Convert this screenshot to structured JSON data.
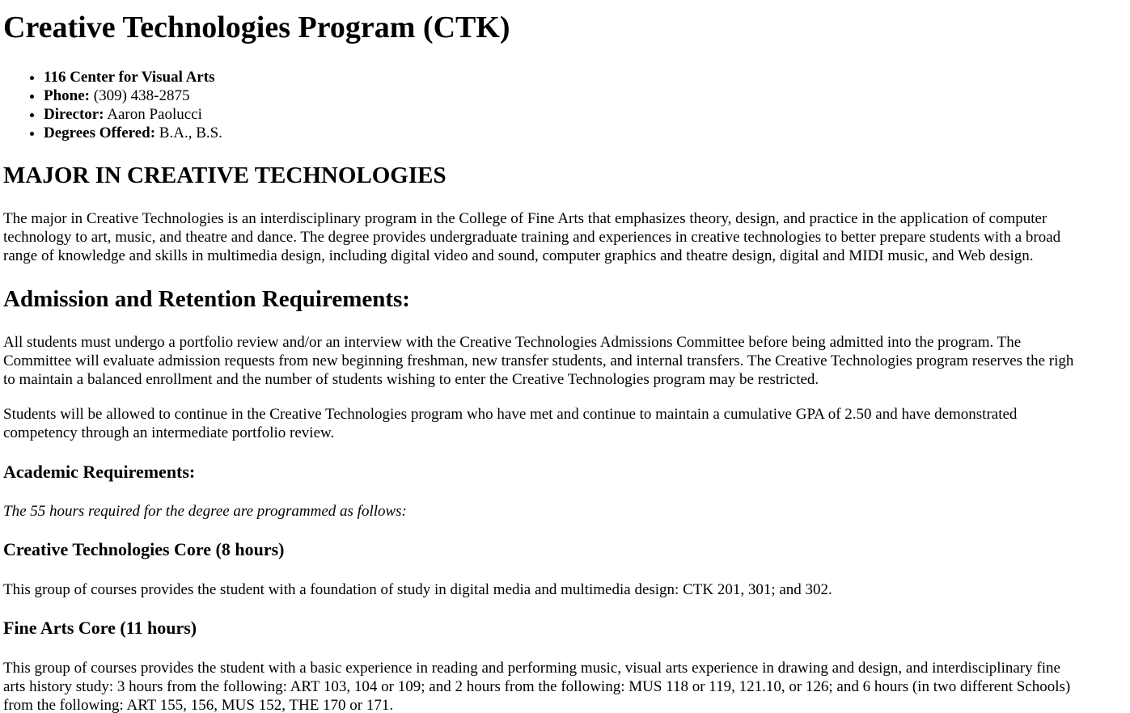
{
  "page_title": "Creative Technologies Program (CTK)",
  "info": {
    "location": "116 Center for Visual Arts",
    "phone_label": "Phone:",
    "phone_value": " (309) 438-2875",
    "director_label": "Director:",
    "director_value": " Aaron Paolucci",
    "degrees_label": "Degrees Offered:",
    "degrees_value": " B.A., B.S."
  },
  "major": {
    "heading": "MAJOR IN CREATIVE TECHNOLOGIES",
    "lines": [
      "The major in Creative Technologies is an interdisciplinary program in the College of Fine Arts that emphasizes theory, design, and practice in the application of computer",
      "technology to art, music, and theatre and dance. The degree provides undergraduate training and experiences in creative technologies to better prepare students with a broad",
      "range of knowledge and skills in multimedia design, including digital video and sound, computer graphics and theatre design, digital and MIDI music, and Web design."
    ]
  },
  "admission": {
    "heading": "Admission and Retention Requirements:",
    "para1_lines": [
      "All students must undergo a portfolio review and/or an interview with the Creative Technologies Admissions Committee before being admitted into the program. The",
      "Committee will evaluate admission requests from new beginning freshman, new transfer students, and internal transfers. The Creative Technologies program reserves the righ",
      "to maintain a balanced enrollment and the number of students wishing to enter the Creative Technologies program may be restricted."
    ],
    "para2_lines": [
      "Students will be allowed to continue in the Creative Technologies program who have met and continue to maintain a cumulative GPA of 2.50 and have demonstrated",
      "competency through an intermediate portfolio review."
    ]
  },
  "academic": {
    "heading": "Academic Requirements:",
    "intro": "The 55 hours required for the degree are programmed as follows:"
  },
  "ct_core": {
    "heading": "Creative Technologies Core (8 hours)",
    "text": "This group of courses provides the student with a foundation of study in digital media and multimedia design: CTK 201, 301; and 302."
  },
  "fine_arts_core": {
    "heading": "Fine Arts Core (11 hours)",
    "lines": [
      "This group of courses provides the student with a basic experience in reading and performing music, visual arts experience in drawing and design, and interdisciplinary fine",
      "arts history study: 3 hours from the following: ART 103, 104 or 109; and 2 hours from the following: MUS 118 or 119, 121.10, or 126; and 6 hours (in two different Schools)",
      "from the following: ART 155, 156, MUS 152, THE 170 or 171."
    ]
  }
}
